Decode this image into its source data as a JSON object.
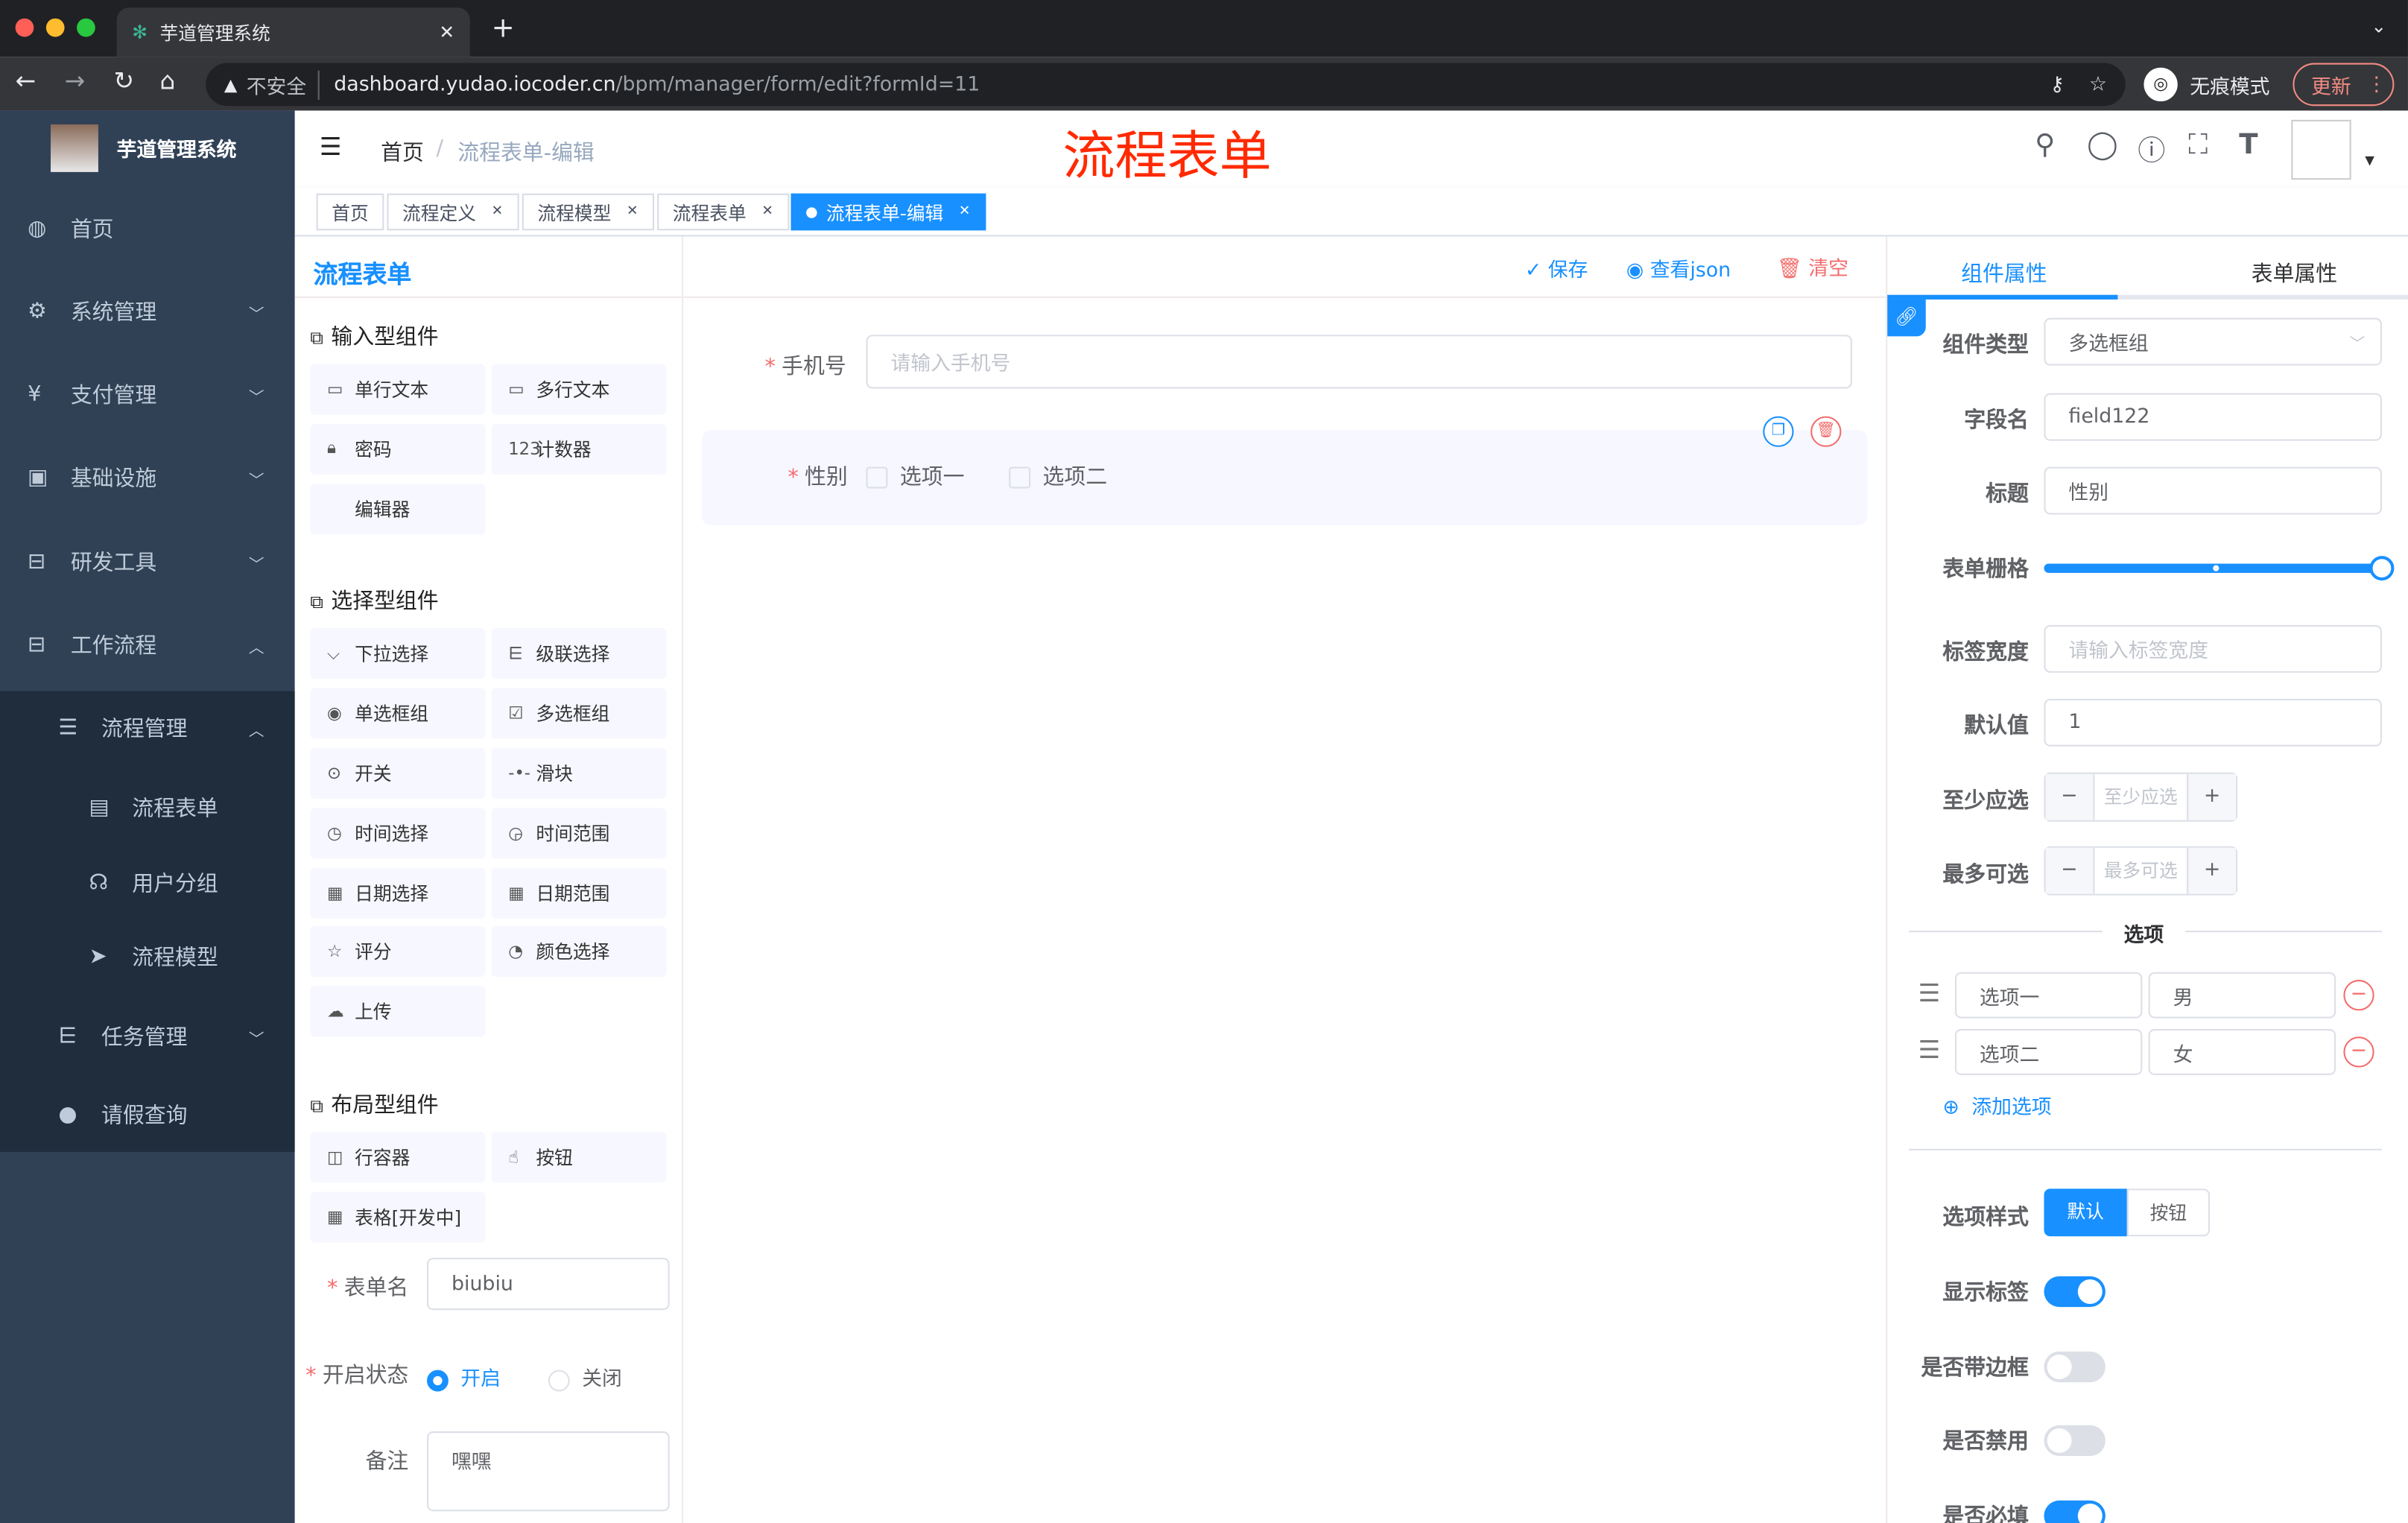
{
  "browser": {
    "tab_title": "芋道管理系统",
    "url_host": "dashboard.yudao.iocoder.cn",
    "url_path": "/bpm/manager/form/edit?formId=11",
    "insecure": "不安全",
    "incognito": "无痕模式",
    "update": "更新"
  },
  "sidebar": {
    "title": "芋道管理系统",
    "items": [
      {
        "label": "首页",
        "icon": "dashboard-icon"
      },
      {
        "label": "系统管理",
        "icon": "gear-icon"
      },
      {
        "label": "支付管理",
        "icon": "yen-icon"
      },
      {
        "label": "基础设施",
        "icon": "monitor-icon"
      },
      {
        "label": "研发工具",
        "icon": "toolbox-icon"
      },
      {
        "label": "工作流程",
        "icon": "toolbox-icon"
      },
      {
        "label": "流程管理",
        "icon": "list-icon"
      },
      {
        "label": "流程表单",
        "icon": "form-icon"
      },
      {
        "label": "用户分组",
        "icon": "group-icon"
      },
      {
        "label": "流程模型",
        "icon": "send-icon"
      },
      {
        "label": "任务管理",
        "icon": "tree-icon"
      },
      {
        "label": "请假查询",
        "icon": "user-icon"
      }
    ]
  },
  "navbar": {
    "breadcrumb": [
      "首页",
      "流程表单-编辑"
    ],
    "overlay_title": "流程表单"
  },
  "tags": [
    "首页",
    "流程定义",
    "流程模型",
    "流程表单",
    "流程表单-编辑"
  ],
  "palette": {
    "logo_title": "流程表单",
    "groups": [
      {
        "title": "输入型组件",
        "items": [
          {
            "label": "单行文本",
            "icon": "▭"
          },
          {
            "label": "多行文本",
            "icon": "▭"
          },
          {
            "label": "密码",
            "icon": "🔒︎"
          },
          {
            "label": "计数器",
            "icon": "123"
          },
          {
            "label": "编辑器",
            "icon": ""
          }
        ]
      },
      {
        "title": "选择型组件",
        "items": [
          {
            "label": "下拉选择",
            "icon": "⌵"
          },
          {
            "label": "级联选择",
            "icon": "⋿"
          },
          {
            "label": "单选框组",
            "icon": "◉"
          },
          {
            "label": "多选框组",
            "icon": "☑"
          },
          {
            "label": "开关",
            "icon": "⊙"
          },
          {
            "label": "滑块",
            "icon": "-•-"
          },
          {
            "label": "时间选择",
            "icon": "◷"
          },
          {
            "label": "时间范围",
            "icon": "◶"
          },
          {
            "label": "日期选择",
            "icon": "▦"
          },
          {
            "label": "日期范围",
            "icon": "▦"
          },
          {
            "label": "评分",
            "icon": "☆"
          },
          {
            "label": "颜色选择",
            "icon": "◔"
          },
          {
            "label": "上传",
            "icon": "☁"
          }
        ]
      },
      {
        "title": "布局型组件",
        "items": [
          {
            "label": "行容器",
            "icon": "◫"
          },
          {
            "label": "按钮",
            "icon": "☝"
          },
          {
            "label": "表格[开发中]",
            "icon": "▦"
          }
        ]
      }
    ],
    "form_name_label": "表单名",
    "form_name": "biubiu",
    "status_label": "开启状态",
    "status_on": "开启",
    "status_off": "关闭",
    "remark_label": "备注",
    "remark": "嘿嘿"
  },
  "toolbar": {
    "save": "保存",
    "view_json": "查看json",
    "clear": "清空"
  },
  "canvas": {
    "phone_label": "手机号",
    "phone_placeholder": "请输入手机号",
    "gender_label": "性别",
    "options": [
      "选项一",
      "选项二"
    ]
  },
  "props": {
    "tabs": [
      "组件属性",
      "表单属性"
    ],
    "active_tab": 0,
    "type_label": "组件类型",
    "type_value": "多选框组",
    "field_label": "字段名",
    "field_value": "field122",
    "title_label": "标题",
    "title_value": "性别",
    "grid_label": "表单栅格",
    "grid_value": 24,
    "grid_max": 24,
    "label_width_label": "标签宽度",
    "label_width_placeholder": "请输入标签宽度",
    "default_label": "默认值",
    "default_value": "1",
    "min_label": "至少应选",
    "min_placeholder": "至少应选",
    "max_label": "最多可选",
    "max_placeholder": "最多可选",
    "options_divider": "选项",
    "options": [
      {
        "label": "选项一",
        "value": "男"
      },
      {
        "label": "选项二",
        "value": "女"
      }
    ],
    "add_option": "添加选项",
    "style_label": "选项样式",
    "style_options": [
      "默认",
      "按钮"
    ],
    "show_label": "显示标签",
    "show_label_on": true,
    "border_label": "是否带边框",
    "border_on": false,
    "disabled_label": "是否禁用",
    "disabled_on": false,
    "required_label": "是否必填",
    "required_on": true
  },
  "colors": {
    "primary": "#1890ff",
    "sidebar": "#304156",
    "danger": "#f56c6c",
    "overlay_title": "#ff2a00"
  }
}
